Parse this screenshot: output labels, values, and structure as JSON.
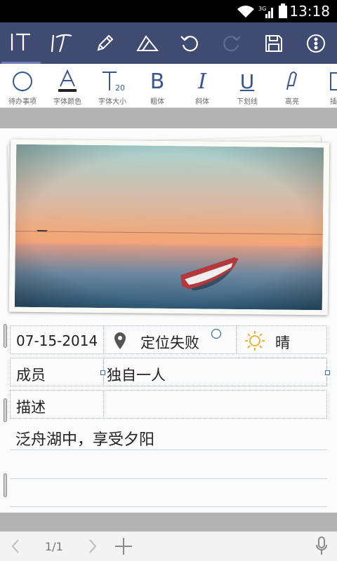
{
  "status_bar": {
    "time": "13:18",
    "net_label": "3G"
  },
  "top_toolbar": {
    "buttons": [
      {
        "name": "text-mode",
        "icon": "text-cursor-icon",
        "selected": true
      },
      {
        "name": "handwriting-mode",
        "icon": "handwriting-t-icon"
      },
      {
        "name": "pen",
        "icon": "pencil-icon"
      },
      {
        "name": "eraser",
        "icon": "eraser-icon"
      },
      {
        "name": "undo",
        "icon": "undo-icon"
      },
      {
        "name": "redo",
        "icon": "redo-icon",
        "disabled": true
      },
      {
        "name": "save",
        "icon": "save-icon"
      },
      {
        "name": "more",
        "icon": "more-icon"
      }
    ]
  },
  "format_toolbar": {
    "items": [
      {
        "label": "待办事项",
        "icon": "circle-icon"
      },
      {
        "label": "字体颜色",
        "icon": "font-color-icon"
      },
      {
        "label": "字体大小",
        "icon": "font-size-icon",
        "size_value": "20"
      },
      {
        "label": "粗体",
        "icon": "bold-icon",
        "glyph": "B"
      },
      {
        "label": "斜体",
        "icon": "italic-icon",
        "glyph": "I"
      },
      {
        "label": "下划线",
        "icon": "underline-icon",
        "glyph": "U"
      },
      {
        "label": "高亮",
        "icon": "highlighter-icon"
      },
      {
        "label": "插",
        "icon": "insert-icon"
      }
    ]
  },
  "note": {
    "date": "07-15-2014",
    "location": "定位失败",
    "weather": "晴",
    "member_label": "成员",
    "member_value": "独自一人",
    "desc_label": "描述",
    "description": "泛舟湖中，享受夕阳"
  },
  "bottom_bar": {
    "page_indicator": "1/1"
  },
  "colors": {
    "toolbar_bg": "#3f4b70",
    "accent_blue": "#3a5590",
    "grey_band": "#b3b3b3"
  }
}
